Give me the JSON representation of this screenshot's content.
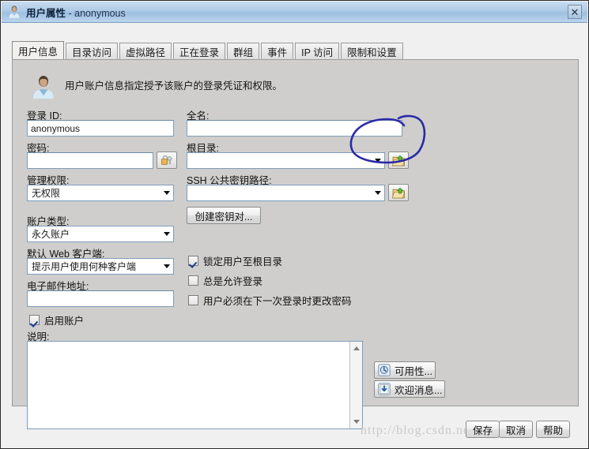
{
  "window": {
    "title": "用户属性",
    "title_suffix": "- anonymous",
    "icon": "user-icon",
    "close_label": "✕"
  },
  "tabs": [
    {
      "label": "用户信息",
      "active": true
    },
    {
      "label": "目录访问",
      "active": false
    },
    {
      "label": "虚拟路径",
      "active": false
    },
    {
      "label": "正在登录",
      "active": false
    },
    {
      "label": "群组",
      "active": false
    },
    {
      "label": "事件",
      "active": false
    },
    {
      "label": "IP 访问",
      "active": false
    },
    {
      "label": "限制和设置",
      "active": false
    }
  ],
  "header": {
    "description": "用户账户信息指定授予该账户的登录凭证和权限。",
    "icon": "user-avatar-icon"
  },
  "left_column": {
    "login_id_label": "登录 ID:",
    "login_id_value": "anonymous",
    "password_label": "密码:",
    "password_value": "",
    "password_button_icon": "lock-key-icon",
    "admin_privilege_label": "管理权限:",
    "admin_privilege_value": "无权限",
    "account_type_label": "账户类型:",
    "account_type_value": "永久账户",
    "default_web_client_label": "默认 Web 客户端:",
    "default_web_client_value": "提示用户使用何种客户端",
    "email_label": "电子邮件地址:",
    "email_value": "",
    "enable_account_label": "启用账户",
    "enable_account_checked": true,
    "description_label": "说明:",
    "description_value": ""
  },
  "right_column": {
    "full_name_label": "全名:",
    "full_name_value": "",
    "root_dir_label": "根目录:",
    "root_dir_value": "",
    "root_dir_browse_icon": "folder-open-icon",
    "ssh_key_label": "SSH 公共密钥路径:",
    "ssh_key_value": "",
    "ssh_key_browse_icon": "folder-open-icon",
    "create_keypair_button": "创建密钥对...",
    "checkboxes": [
      {
        "label": "锁定用户至根目录",
        "checked": true
      },
      {
        "label": "总是允许登录",
        "checked": false
      },
      {
        "label": "用户必须在下一次登录时更改密码",
        "checked": false
      }
    ]
  },
  "side_actions": [
    {
      "label": "可用性...",
      "icon": "availability-clock-icon"
    },
    {
      "label": "欢迎消息...",
      "icon": "welcome-message-icon"
    }
  ],
  "footer_buttons": [
    {
      "label": "保存"
    },
    {
      "label": "取消"
    },
    {
      "label": "帮助"
    }
  ],
  "annotation": {
    "type": "hand-drawn-ellipse",
    "color": "#2a2aa8",
    "target": "root-directory-browse-button"
  },
  "watermark": "http://blog.csdn.net/zack_GZ"
}
